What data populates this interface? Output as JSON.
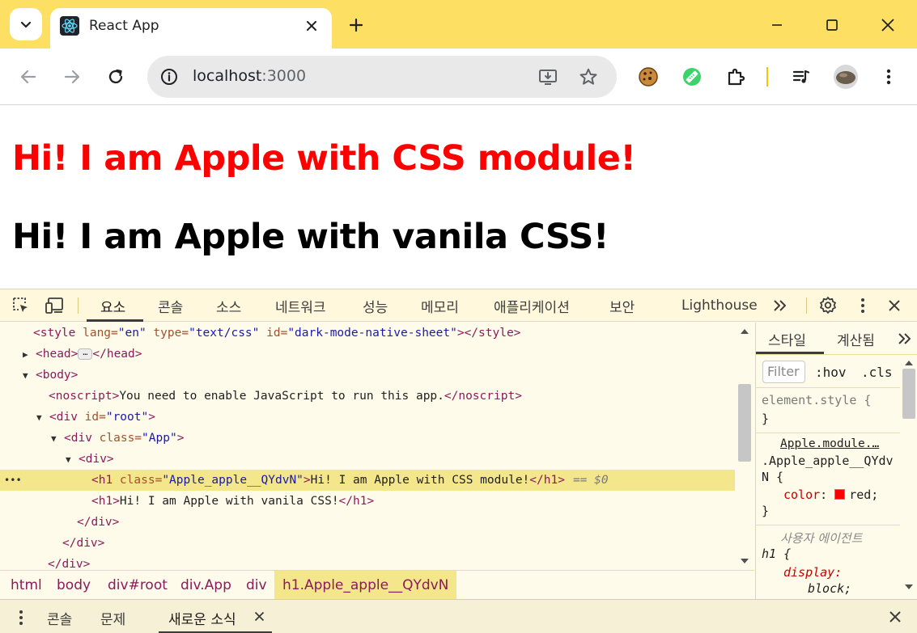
{
  "browser": {
    "tab": {
      "title": "React App"
    },
    "address_bar": {
      "host": "localhost",
      "port": ":3000"
    }
  },
  "page": {
    "heading_css_module": "Hi! I am Apple with CSS module!",
    "heading_vanilla": "Hi! I am Apple with vanila CSS!",
    "colors": {
      "css_module_heading": "#ff0000",
      "vanilla_heading": "#000000"
    }
  },
  "devtools": {
    "tabs": [
      "요소",
      "콘솔",
      "소스",
      "네트워크",
      "성능",
      "메모리",
      "애플리케이션",
      "보안",
      "Lighthouse"
    ],
    "active_tab": "요소",
    "dom": {
      "style_line": {
        "tag_open": "<style",
        "lang_attr": " lang=",
        "lang_val": "\"en\"",
        "type_attr": " type=",
        "type_val": "\"text/css\"",
        "id_attr": " id=",
        "id_val": "\"dark-mode-native-sheet\"",
        "tag_close": "></style>"
      },
      "head_open": "<head>",
      "head_ellipsis": "…",
      "head_close": "</head>",
      "body_open": "<body>",
      "noscript_open": "<noscript>",
      "noscript_text": "You need to enable JavaScript to run this app.",
      "noscript_close": "</noscript>",
      "div_root": {
        "tag_open": "<div",
        "attr": " id=",
        "val": "\"root\"",
        "close": ">"
      },
      "div_app": {
        "tag_open": "<div",
        "attr": " class=",
        "val": "\"App\"",
        "close": ">"
      },
      "div_plain": "<div>",
      "h1_selected": {
        "tag_open": "<h1",
        "attr": " class=",
        "val": "\"Apple_apple__QYdvN\"",
        "close": ">",
        "text": "Hi! I am Apple with CSS module!",
        "end": "</h1>",
        "marker": "== $0"
      },
      "h1_vanilla": {
        "open": "<h1>",
        "text": "Hi! I am Apple with vanila CSS!",
        "end": "</h1>"
      },
      "div_close": "</div>"
    },
    "breadcrumb": [
      "html",
      "body",
      "div#root",
      "div.App",
      "div",
      "h1.Apple_apple__QYdvN"
    ],
    "styles": {
      "tabs": [
        "스타일",
        "계산됨"
      ],
      "filter_placeholder": "Filter",
      "hov": ":hov",
      "cls": ".cls",
      "element_style": "element.style {",
      "close_brace": "}",
      "source_link": "Apple.module.…",
      "selector_line1": ".Apple_apple__QYdv",
      "selector_line2": "N {",
      "prop_color": "color",
      "prop_color_value": "red;",
      "user_agent_label": "사용자 에이전트",
      "ua_selector": "h1 {",
      "ua_prop": "display",
      "ua_value": "block;"
    },
    "drawer_tabs": [
      "콘솔",
      "문제",
      "새로운 소식"
    ]
  }
}
